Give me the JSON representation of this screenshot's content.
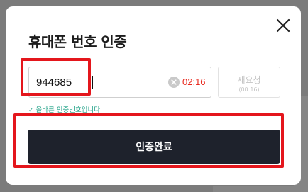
{
  "modal": {
    "title": "휴대폰 번호 인증",
    "close_icon": "close-icon"
  },
  "verification": {
    "code_value": "944685",
    "clear_icon": "clear-icon",
    "timer": "02:16",
    "resend_label": "재요청",
    "resend_timer": "(00:16)",
    "valid_check_icon": "check-icon",
    "valid_message": "올바른 인증번호입니다."
  },
  "actions": {
    "confirm_label": "인증완료"
  },
  "colors": {
    "timer": "#e8291e",
    "valid": "#20a187",
    "button_bg": "#1e222c",
    "highlight": "#e4161c"
  }
}
